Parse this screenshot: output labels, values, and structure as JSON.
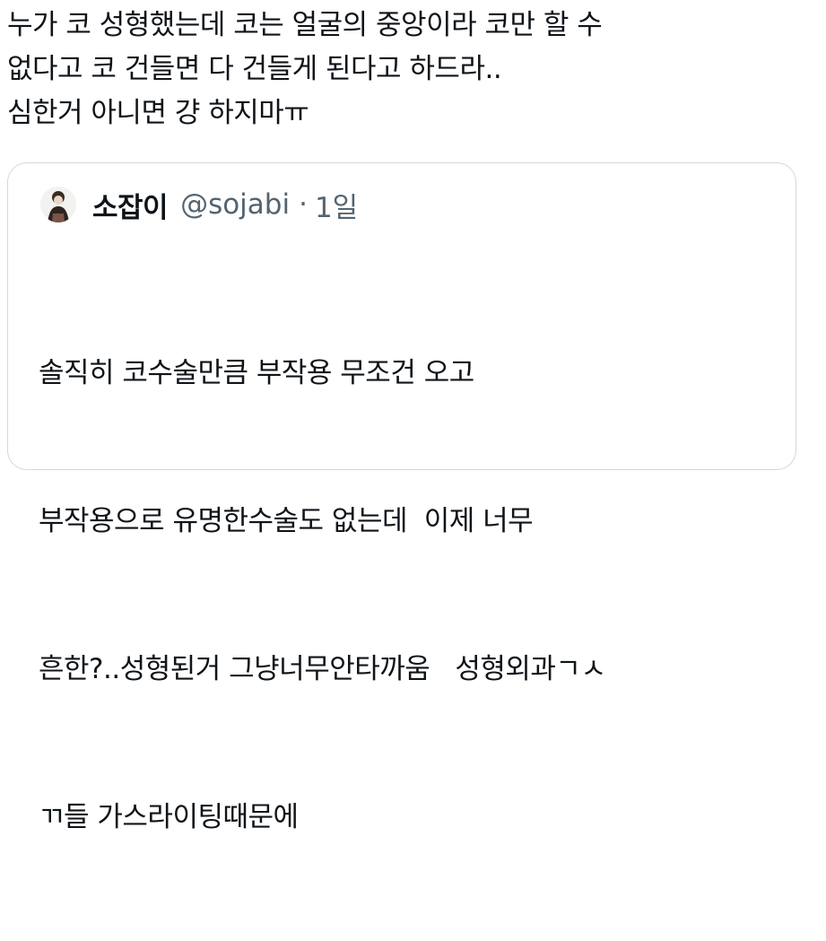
{
  "tweet": {
    "lines": [
      "누가 코 성형했는데 코는 얼굴의 중앙이라 코만 할 수",
      "없다고 코 건들면 다 건들게 된다고 하드라..",
      "심한거 아니면 걍 하지마ㅠ"
    ]
  },
  "quote": {
    "avatar_icon": "user-avatar-icon",
    "display_name": "소잡이",
    "handle": "@sojabi",
    "separator": "·",
    "time": "1일",
    "lines": [
      "솔직히 코수술만큼 부작용 무조건 오고",
      "부작용으로 유명한수술도 없는데  이제 너무",
      "흔한?..성형된거 그냥너무안타까움   성형외과ㄱㅅ",
      "ㄲ들 가스라이팅때문에"
    ]
  },
  "colors": {
    "text": "#0f1419",
    "secondary_text": "#536471",
    "border": "#cfd9de",
    "background": "#ffffff"
  }
}
